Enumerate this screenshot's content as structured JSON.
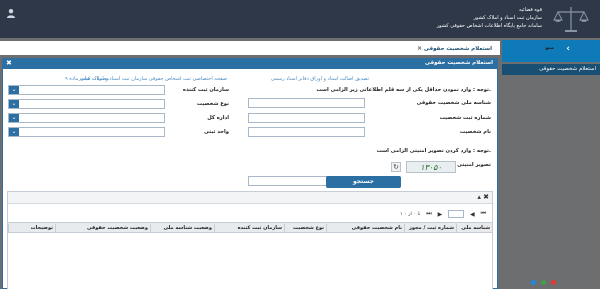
{
  "header": {
    "org_line1": "قوه قضائیه",
    "org_line2": "سازمان ثبت اسناد و املاک کشور",
    "org_line3": "سامانه جامع پایگاه اطلاعات اشخاص حقوقی کشور"
  },
  "sidebar": {
    "menu_label": "منو",
    "menu_chevron": "‹",
    "active_item": "استعلام شخصیت حقوقی",
    "dot_colors": [
      "#1e88e5",
      "#43a047",
      "#e53935"
    ]
  },
  "tab": {
    "label": "استعلام شخصیت حقوقی",
    "close": "×"
  },
  "panel": {
    "title": "استعلام شخصیت حقوقی",
    "close": "✖",
    "links": [
      "تصدیق اصالت اسناد و اوراق دفاتر اسناد رسمی",
      "صفحه اختصاصی ثبت اشخاص حقوقی سازمان ثبت اسناد و املاک کشور",
      "مصوبات هیات ماده ۹"
    ],
    "note1": "توجه : وارد نمودن حداقل یکی از سه قلم اطلاعاتی زیر الزامی است.",
    "note2": "توجه : وارد کردن تصویر امنیتی الزامی است.",
    "fields": {
      "national_id": "شناسه ملی شخصیت حقوقی",
      "reg_number": "شماره ثبت شخصیت",
      "name": "نام شخصیت",
      "reg_org": "سازمان ثبت کننده",
      "entity_type": "نوع شخصیت",
      "general_office": "اداره کل",
      "reg_unit": "واحد ثبتی",
      "captcha_label": "تصویر امنیتی"
    },
    "captcha_text": "۱۳۰۵۰",
    "refresh_glyph": "↻",
    "search_button": "جستجو"
  },
  "grid": {
    "toolbar_icons": "▴ ✖",
    "pager": {
      "first": "⏮",
      "prev": "◀",
      "page_value": "1",
      "of": "از",
      "next": "▶",
      "last": "⏭",
      "range": "۱ تا ۰ از ۰"
    },
    "columns": [
      "شناسه ملی",
      "شماره ثبت / مجوز",
      "نام شخصیت حقوقی",
      "نوع شخصیت",
      "سازمان ثبت کننده",
      "وضعیت شناسه ملی",
      "وضعیت شخصیت حقوقی",
      "توضیحات"
    ]
  }
}
